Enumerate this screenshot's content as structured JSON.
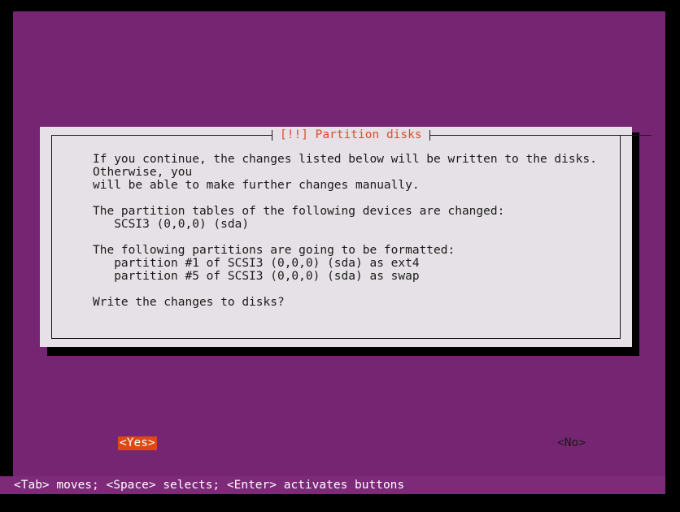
{
  "screen": {
    "background_color": "#762572",
    "frame_color": "#000000"
  },
  "dialog": {
    "title": "[!!] Partition disks",
    "title_color": "#e04a32",
    "background_color": "#e6e1e6",
    "text_color": "#1a1a1a",
    "intro_paragraph": "If you continue, the changes listed below will be written to the disks. Otherwise, you\nwill be able to make further changes manually.",
    "tables_heading": "The partition tables of the following devices are changed:",
    "tables_devices": [
      "   SCSI3 (0,0,0) (sda)"
    ],
    "format_heading": "The following partitions are going to be formatted:",
    "format_partitions": [
      "   partition #1 of SCSI3 (0,0,0) (sda) as ext4",
      "   partition #5 of SCSI3 (0,0,0) (sda) as swap"
    ],
    "question": "Write the changes to disks?",
    "buttons": {
      "yes_label": "<Yes>",
      "no_label": "<No>",
      "selected": "yes",
      "highlight_color": "#dd4814",
      "highlight_text_color": "#ffffff"
    }
  },
  "status_bar": {
    "text": "<Tab> moves; <Space> selects; <Enter> activates buttons",
    "background_color": "#7d2a79",
    "text_color": "#ffffff"
  }
}
